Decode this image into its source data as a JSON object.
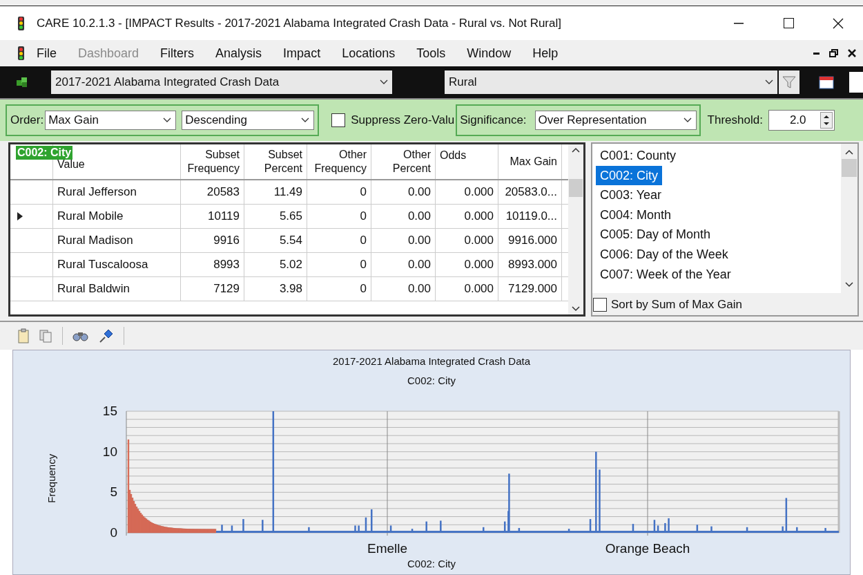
{
  "window": {
    "title": "CARE 10.2.1.3 - [IMPACT Results - 2017-2021 Alabama Integrated Crash Data - Rural vs. Not Rural]"
  },
  "menu": [
    {
      "label": "File",
      "disabled": false
    },
    {
      "label": "Dashboard",
      "disabled": true
    },
    {
      "label": "Filters",
      "disabled": false
    },
    {
      "label": "Analysis",
      "disabled": false
    },
    {
      "label": "Impact",
      "disabled": false
    },
    {
      "label": "Locations",
      "disabled": false
    },
    {
      "label": "Tools",
      "disabled": false
    },
    {
      "label": "Window",
      "disabled": false
    },
    {
      "label": "Help",
      "disabled": false
    }
  ],
  "toolbar": {
    "dataset": "2017-2021 Alabama Integrated Crash Data",
    "filter": "Rural"
  },
  "options": {
    "order_label": "Order:",
    "order": "Max Gain",
    "direction": "Descending",
    "suppress_label": "Suppress Zero-Valu",
    "suppress_checked": false,
    "significance_label": "Significance:",
    "significance": "Over Representation",
    "threshold_label": "Threshold:",
    "threshold": "2.0"
  },
  "grid": {
    "badge": "C002: City",
    "columns": [
      "Value",
      "Subset Frequency",
      "Subset Percent",
      "Other Frequency",
      "Other Percent",
      "Odds",
      "Max Gain"
    ],
    "rows": [
      {
        "current": false,
        "cells": [
          "Rural Jefferson",
          "20583",
          "11.49",
          "0",
          "0.00",
          "0.000",
          "20583.0..."
        ]
      },
      {
        "current": true,
        "cells": [
          "Rural Mobile",
          "10119",
          "5.65",
          "0",
          "0.00",
          "0.000",
          "10119.0..."
        ]
      },
      {
        "current": false,
        "cells": [
          "Rural Madison",
          "9916",
          "5.54",
          "0",
          "0.00",
          "0.000",
          "9916.000"
        ]
      },
      {
        "current": false,
        "cells": [
          "Rural Tuscaloosa",
          "8993",
          "5.02",
          "0",
          "0.00",
          "0.000",
          "8993.000"
        ]
      },
      {
        "current": false,
        "cells": [
          "Rural Baldwin",
          "7129",
          "3.98",
          "0",
          "0.00",
          "0.000",
          "7129.000"
        ]
      }
    ]
  },
  "variables": {
    "items": [
      {
        "label": "C001: County",
        "selected": false
      },
      {
        "label": "C002: City",
        "selected": true
      },
      {
        "label": "C003: Year",
        "selected": false
      },
      {
        "label": "C004: Month",
        "selected": false
      },
      {
        "label": "C005: Day of Month",
        "selected": false
      },
      {
        "label": "C006: Day of the Week",
        "selected": false
      },
      {
        "label": "C007: Week of the Year",
        "selected": false
      }
    ],
    "sort_label": "Sort by Sum of Max Gain",
    "sort_checked": false
  },
  "chart": {
    "title": "2017-2021 Alabama Integrated Crash Data",
    "subtitle": "C002: City",
    "ylabel": "Frequency",
    "yticks": [
      "15",
      "10",
      "5",
      "0"
    ],
    "xticks": [
      "Emelle",
      "Orange Beach"
    ],
    "xlabel": "C002: City"
  }
}
